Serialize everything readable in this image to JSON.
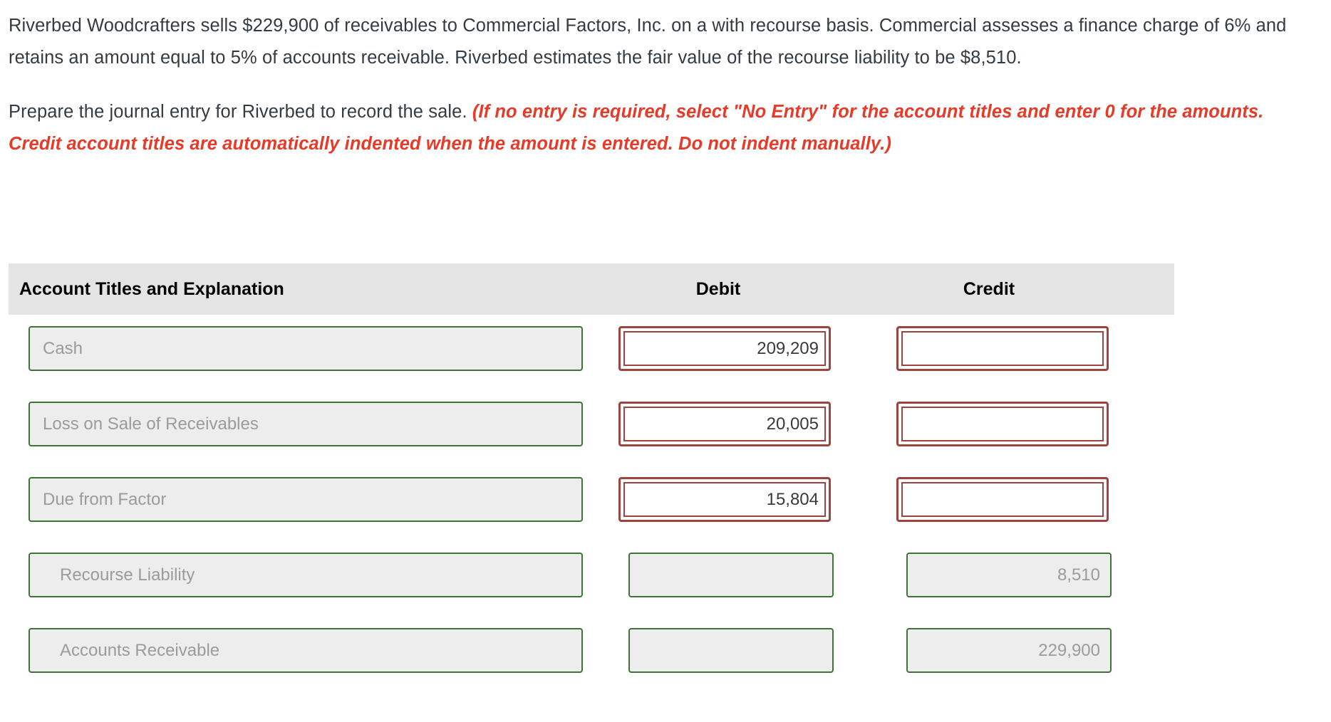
{
  "problem": {
    "paragraph1": "Riverbed Woodcrafters sells $229,900 of receivables to Commercial Factors, Inc. on a with recourse basis. Commercial assesses a finance charge of 6% and retains an amount equal to 5% of accounts receivable. Riverbed estimates the fair value of the recourse liability to be $8,510.",
    "paragraph2_lead": "Prepare the journal entry for Riverbed to record the sale. ",
    "paragraph2_requirement": "(If no entry is required, select \"No Entry\" for the account titles and enter 0 for the amounts. Credit account titles are automatically indented when the amount is entered. Do not indent manually.)",
    "requirement_color": "#E83A28"
  },
  "journal_table": {
    "headers": {
      "account": "Account Titles and Explanation",
      "debit": "Debit",
      "credit": "Credit"
    },
    "header_background": "#E4E4E4",
    "border_valid_color": "#3F7338",
    "border_flagged_color": "#9B4440",
    "field_fill_disabled": "#EDEDED",
    "placeholder_color": "#9B9B9B",
    "rows": [
      {
        "account": "Cash",
        "account_indented": false,
        "debit": "209,209",
        "credit": "",
        "debit_state": "active",
        "credit_state": "active"
      },
      {
        "account": "Loss on Sale of Receivables",
        "account_indented": false,
        "debit": "20,005",
        "credit": "",
        "debit_state": "active",
        "credit_state": "active"
      },
      {
        "account": "Due from Factor",
        "account_indented": false,
        "debit": "15,804",
        "credit": "",
        "debit_state": "active",
        "credit_state": "active"
      },
      {
        "account": "Recourse Liability",
        "account_indented": true,
        "debit": "",
        "credit": "8,510",
        "debit_state": "disabled",
        "credit_state": "disabled"
      },
      {
        "account": "Accounts Receivable",
        "account_indented": true,
        "debit": "",
        "credit": "229,900",
        "debit_state": "disabled",
        "credit_state": "disabled"
      }
    ]
  }
}
